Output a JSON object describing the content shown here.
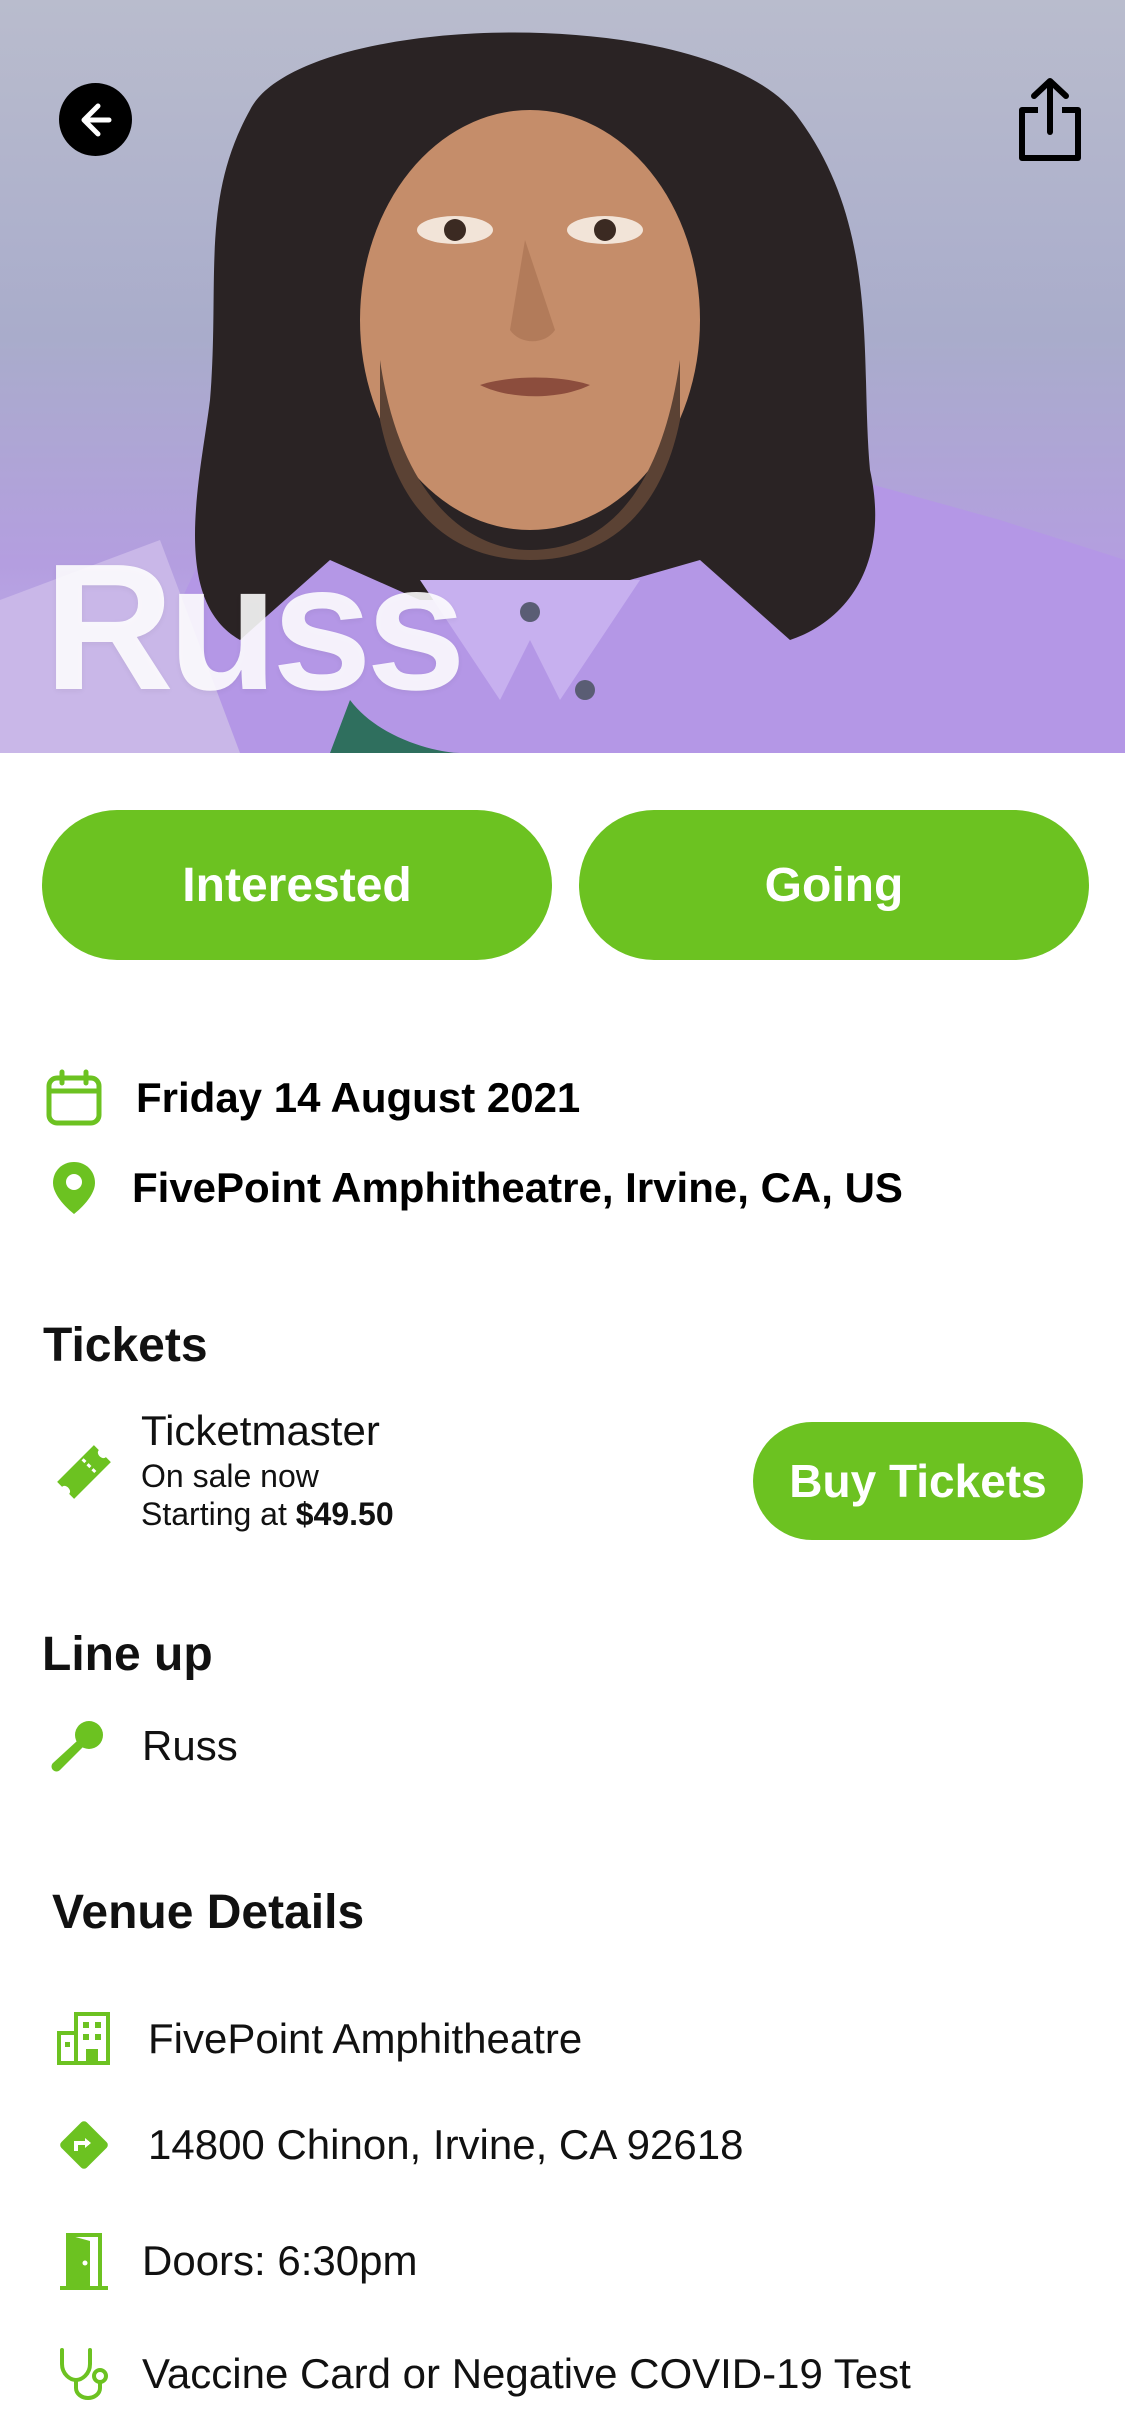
{
  "hero": {
    "title": "Russ"
  },
  "actions": {
    "interested_label": "Interested",
    "going_label": "Going"
  },
  "event": {
    "date": "Friday 14 August 2021",
    "location": "FivePoint Amphitheatre, Irvine, CA, US"
  },
  "tickets": {
    "heading": "Tickets",
    "provider": "Ticketmaster",
    "status": "On sale now",
    "starting_prefix": "Starting at",
    "price": "$49.50",
    "buy_label": "Buy Tickets"
  },
  "lineup": {
    "heading": "Line up",
    "artists": [
      "Russ"
    ]
  },
  "venue": {
    "heading": "Venue Details",
    "name": "FivePoint Amphitheatre",
    "address": "14800 Chinon, Irvine, CA 92618",
    "doors": "Doors: 6:30pm",
    "requirement": "Vaccine Card or Negative COVID-19 Test"
  },
  "colors": {
    "accent": "#6cc221",
    "text": "#111111",
    "background": "#ffffff"
  },
  "icons": {
    "back": "arrow-left-icon",
    "share": "share-icon",
    "date": "calendar-icon",
    "location": "map-pin-icon",
    "ticket": "ticket-icon",
    "lineup": "microphone-icon",
    "venue": "building-icon",
    "address": "directions-icon",
    "doors": "door-icon",
    "health": "stethoscope-icon"
  }
}
